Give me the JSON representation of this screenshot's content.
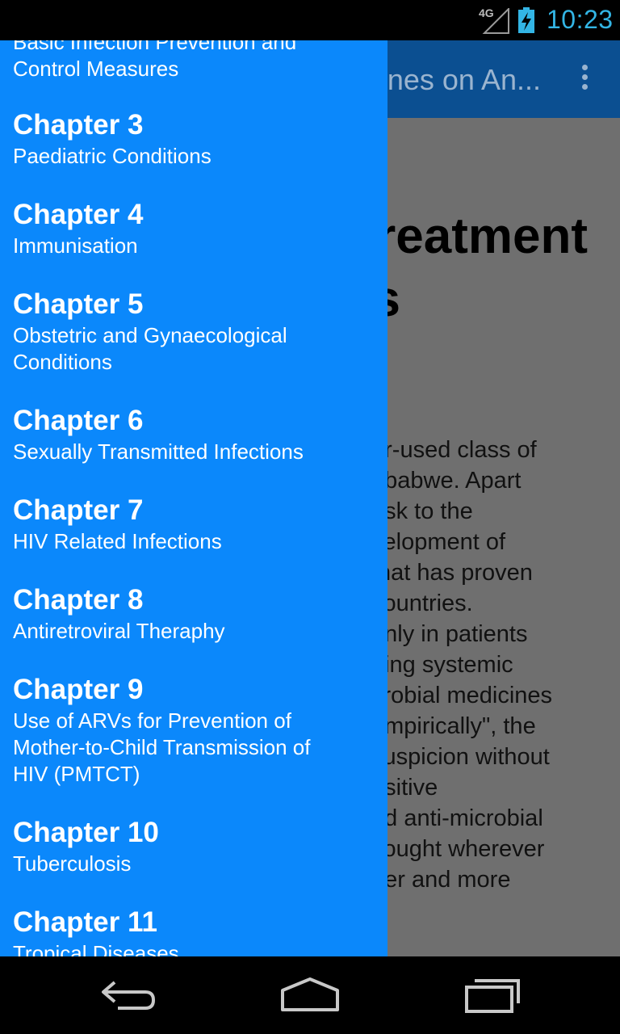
{
  "status_bar": {
    "network": "4G",
    "time": "10:23",
    "icons": [
      "signal-icon",
      "battery-charging-icon"
    ]
  },
  "app_bar": {
    "title": "nes on An...",
    "overflow_icon": "overflow-menu-icon"
  },
  "article": {
    "heading_line1": "reatment",
    "heading_line2": "s",
    "body_lines": [
      "er-used class of",
      "nbabwe. Apart",
      "risk to the",
      "velopment of",
      "that has proven",
      "countries.",
      "only in patients",
      "iring systemic",
      "crobial medicines",
      "empirically\", the",
      "suspicion without",
      "ositive",
      "nd anti-microbial",
      "sought wherever",
      "tter and more"
    ]
  },
  "drawer": {
    "items": [
      {
        "chapter": "",
        "subtitle_lines": [
          "Basic Infection Prevention and",
          "Control Measures"
        ]
      },
      {
        "chapter": "Chapter 3",
        "subtitle_lines": [
          "Paediatric Conditions"
        ]
      },
      {
        "chapter": "Chapter 4",
        "subtitle_lines": [
          "Immunisation"
        ]
      },
      {
        "chapter": "Chapter 5",
        "subtitle_lines": [
          "Obstetric and Gynaecological",
          "Conditions"
        ]
      },
      {
        "chapter": "Chapter 6",
        "subtitle_lines": [
          "Sexually Transmitted Infections"
        ]
      },
      {
        "chapter": "Chapter 7",
        "subtitle_lines": [
          "HIV Related Infections"
        ]
      },
      {
        "chapter": "Chapter 8",
        "subtitle_lines": [
          "Antiretroviral Theraphy"
        ]
      },
      {
        "chapter": "Chapter 9",
        "subtitle_lines": [
          "Use of ARVs for Prevention of",
          "Mother-to-Child Transmission of",
          "HIV (PMTCT)"
        ]
      },
      {
        "chapter": "Chapter 10",
        "subtitle_lines": [
          "Tuberculosis"
        ]
      },
      {
        "chapter": "Chapter 11",
        "subtitle_lines": [
          "Tropical Diseases"
        ]
      }
    ]
  },
  "nav_bar": {
    "buttons": [
      "back-icon",
      "home-icon",
      "recent-apps-icon"
    ]
  },
  "colors": {
    "drawer_bg": "#0b88fb",
    "app_bar": "#0b4f91",
    "status_accent": "#33b5e5",
    "scrim_content": "#6f6f6f"
  }
}
